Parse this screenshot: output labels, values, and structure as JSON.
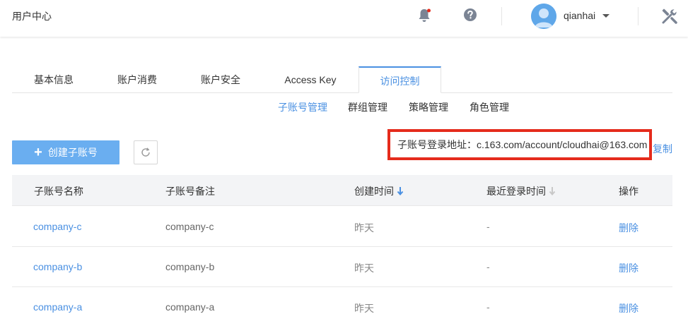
{
  "header": {
    "app_title": "用户中心",
    "username": "qianhai",
    "notification_dot_color": "#e52b1c"
  },
  "tabs": [
    {
      "label": "基本信息",
      "active": false
    },
    {
      "label": "账户消费",
      "active": false
    },
    {
      "label": "账户安全",
      "active": false
    },
    {
      "label": "Access Key",
      "active": false
    },
    {
      "label": "访问控制",
      "active": true
    }
  ],
  "subtabs": [
    {
      "label": "子账号管理",
      "active": true
    },
    {
      "label": "群组管理",
      "active": false
    },
    {
      "label": "策略管理",
      "active": false
    },
    {
      "label": "角色管理",
      "active": false
    }
  ],
  "actions": {
    "create_label": "创建子账号",
    "login_url_text": "子账号登录地址：c.163.com/account/cloudhai@163.com",
    "copy_label": "复制"
  },
  "table": {
    "columns": [
      "子账号名称",
      "子账号备注",
      "创建时间",
      "最近登录时间",
      "操作"
    ],
    "rows": [
      {
        "name": "company-c",
        "remark": "company-c",
        "created": "昨天",
        "last_login": "-",
        "action": "删除"
      },
      {
        "name": "company-b",
        "remark": "company-b",
        "created": "昨天",
        "last_login": "-",
        "action": "删除"
      },
      {
        "name": "company-a",
        "remark": "company-a",
        "created": "昨天",
        "last_login": "-",
        "action": "删除"
      }
    ]
  },
  "colors": {
    "accent": "#4a90e2",
    "button": "#6aaef0",
    "highlight_border": "#e52b1c"
  }
}
